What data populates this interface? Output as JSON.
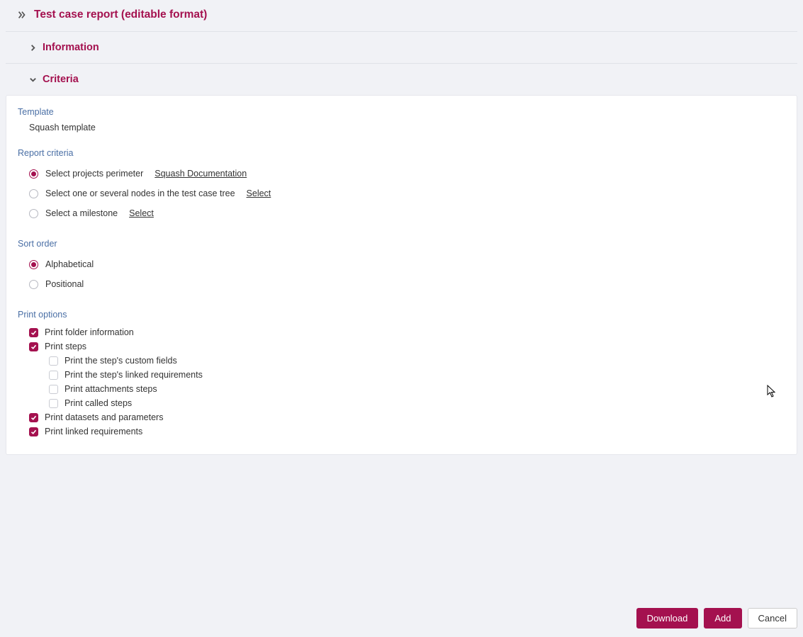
{
  "header": {
    "title": "Test case report (editable format)"
  },
  "sections": {
    "information": {
      "title": "Information"
    },
    "criteria": {
      "title": "Criteria"
    }
  },
  "template": {
    "label": "Template",
    "value": "Squash template"
  },
  "report_criteria": {
    "label": "Report criteria",
    "options": {
      "perimeter": {
        "label": "Select projects perimeter",
        "link": "Squash Documentation",
        "checked": true
      },
      "nodes": {
        "label": "Select one or several nodes in the test case tree",
        "link": "Select",
        "checked": false
      },
      "milestone": {
        "label": "Select a milestone",
        "link": "Select",
        "checked": false
      }
    }
  },
  "sort_order": {
    "label": "Sort order",
    "options": {
      "alphabetical": {
        "label": "Alphabetical",
        "checked": true
      },
      "positional": {
        "label": "Positional",
        "checked": false
      }
    }
  },
  "print_options": {
    "label": "Print options",
    "items": {
      "folder_info": {
        "label": "Print folder information",
        "checked": true
      },
      "steps": {
        "label": "Print steps",
        "checked": true
      },
      "custom_fields": {
        "label": "Print the step's custom fields",
        "checked": false
      },
      "linked_reqs_step": {
        "label": "Print the step's linked requirements",
        "checked": false
      },
      "attachments": {
        "label": "Print attachments steps",
        "checked": false
      },
      "called_steps": {
        "label": "Print called steps",
        "checked": false
      },
      "datasets": {
        "label": "Print datasets and parameters",
        "checked": true
      },
      "linked_reqs": {
        "label": "Print linked requirements",
        "checked": true
      }
    }
  },
  "footer": {
    "download": "Download",
    "add": "Add",
    "cancel": "Cancel"
  }
}
